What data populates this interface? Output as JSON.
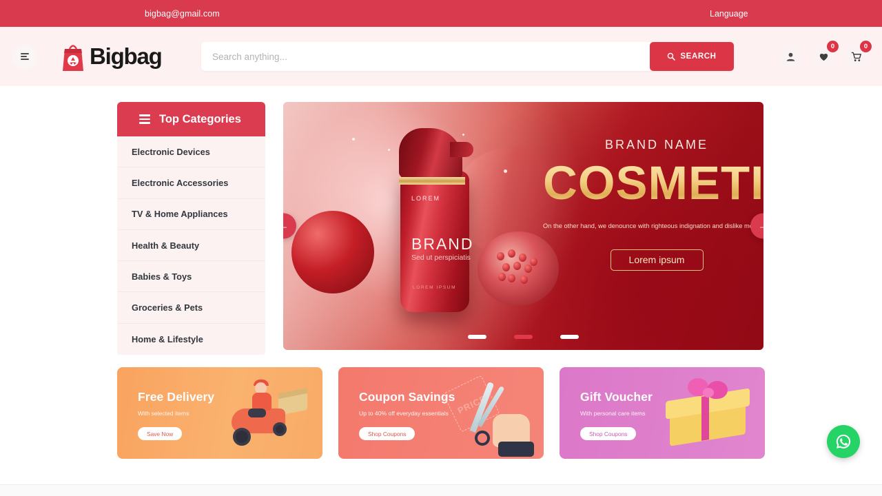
{
  "topbar": {
    "email": "bigbag@gmail.com",
    "language": "Language"
  },
  "header": {
    "logo_text": "Bigbag",
    "search": {
      "placeholder": "Search anything...",
      "value": "",
      "button_label": "SEARCH"
    },
    "icons": [
      {
        "name": "account-icon",
        "badge": null
      },
      {
        "name": "wishlist-heart-icon",
        "badge": "0"
      },
      {
        "name": "cart-icon",
        "badge": "0"
      }
    ]
  },
  "sidebar": {
    "title": "Top Categories",
    "items": [
      {
        "label": "Electronic Devices"
      },
      {
        "label": "Electronic Accessories"
      },
      {
        "label": "TV & Home Appliances"
      },
      {
        "label": "Health & Beauty"
      },
      {
        "label": "Babies & Toys"
      },
      {
        "label": "Groceries & Pets"
      },
      {
        "label": "Home & Lifestyle"
      }
    ]
  },
  "hero": {
    "brand_label": "BRAND NAME",
    "title": "COSMETIC",
    "description": "On the other hand, we denounce with righteous indignation and dislike men who are so beguiled and demoralized by the charms of pleasure of the moment",
    "cta_label": "Lorem ipsum",
    "product": {
      "cap_label": "LOREM",
      "brand": "BRAND",
      "tagline": "Sed ut perspiciatis",
      "footnote": "LOREM IPSUM"
    },
    "prev_label": "←",
    "next_label": "→",
    "dots": [
      {
        "active": false
      },
      {
        "active": true
      },
      {
        "active": false
      }
    ]
  },
  "promos": [
    {
      "title": "Free Delivery",
      "subtitle": "With selected items",
      "button_label": "Save Now",
      "art": "delivery-scooter",
      "color": "#f9a35f"
    },
    {
      "title": "Coupon Savings",
      "subtitle": "Up to 40% off everyday essentials",
      "button_label": "Shop Coupons",
      "art": "scissors-price-tag",
      "color": "#f4796d"
    },
    {
      "title": "Gift Voucher",
      "subtitle": "With personal care items",
      "button_label": "Shop Coupons",
      "art": "gift-box",
      "color": "#dc78c8"
    }
  ],
  "floating": {
    "whatsapp_label": "WhatsApp"
  },
  "colors": {
    "brand_red": "#dc3545",
    "topbar_red": "#d93a4d",
    "header_bg": "#fdf1f1",
    "whatsapp_green": "#25d366"
  }
}
